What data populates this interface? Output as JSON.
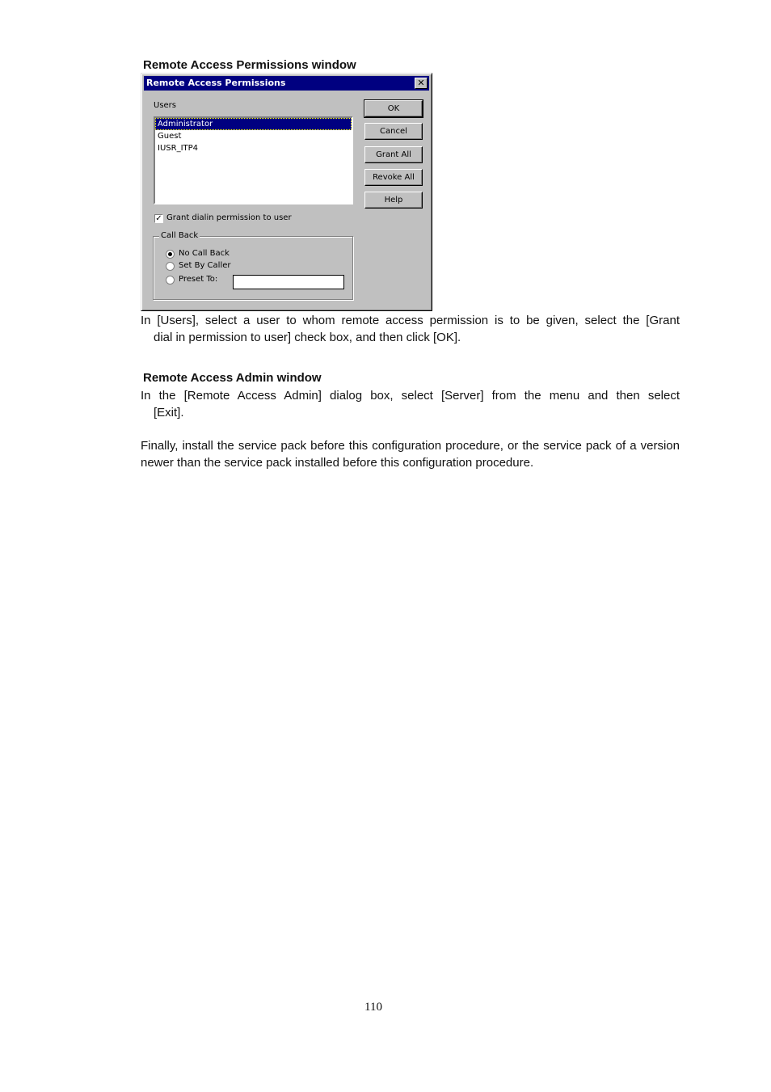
{
  "captions": {
    "permissions_window": "Remote Access Permissions window",
    "admin_window": "Remote Access Admin window"
  },
  "dialog": {
    "title": "Remote Access Permissions",
    "close_icon": "close-icon",
    "users_label": "Users",
    "users": [
      {
        "name": "Administrator",
        "selected": true
      },
      {
        "name": "Guest",
        "selected": false
      },
      {
        "name": "IUSR_ITP4",
        "selected": false
      }
    ],
    "buttons": {
      "ok": "OK",
      "cancel": "Cancel",
      "grant_all": "Grant All",
      "revoke_all": "Revoke All",
      "help": "Help"
    },
    "grant_checkbox": {
      "label": "Grant dialin permission to user",
      "checked": true
    },
    "callback": {
      "group_label": "Call Back",
      "options": [
        {
          "label": "No Call Back",
          "selected": true
        },
        {
          "label": "Set By Caller",
          "selected": false
        },
        {
          "label": "Preset To:",
          "selected": false
        }
      ],
      "preset_value": ""
    }
  },
  "paragraphs": {
    "p1_line1": "In [Users], select a user to whom remote access permission is to be given, select the [Grant",
    "p1_line2": "dial in permission to user] check box, and then click [OK].",
    "p2_line1": "In the [Remote Access Admin] dialog box, select [Server] from the menu and then select",
    "p2_line2": "[Exit].",
    "p3": "Finally, install the service pack before this configuration procedure, or the service pack of a version newer than the service pack installed before this configuration procedure."
  },
  "page_number": "110"
}
